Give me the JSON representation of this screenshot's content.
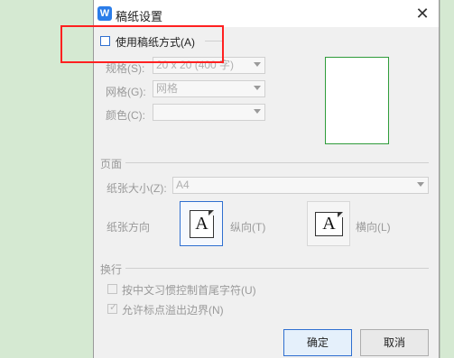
{
  "dialog": {
    "title": "稿纸设置",
    "app_icon": "W",
    "close": "✕"
  },
  "use_grid": {
    "label": "使用稿纸方式(A)",
    "checked": false
  },
  "spec": {
    "label": "规格(S):",
    "value": "20 x 20 (400 字)"
  },
  "grid": {
    "label": "网格(G):",
    "value": "网格"
  },
  "color": {
    "label": "颜色(C):",
    "value": ""
  },
  "page": {
    "section_label": "页面",
    "paper_size_label": "纸张大小(Z):",
    "paper_size_value": "A4",
    "orientation_label": "纸张方向",
    "portrait_label": "纵向(T)",
    "landscape_label": "横向(L)",
    "icon_letter": "A"
  },
  "wrap": {
    "section_label": "换行",
    "punct_control_label": "按中文习惯控制首尾字符(U)",
    "punct_control_checked": false,
    "overflow_label": "允许标点溢出边界(N)",
    "overflow_checked": true,
    "check_glyph": "✓"
  },
  "buttons": {
    "ok": "确定",
    "cancel": "取消"
  },
  "colors": {
    "background": "#d5e9d2",
    "dialog": "#f0f0f0",
    "accent": "#2f6fd0",
    "preview_border": "#2f9c3a",
    "highlight": "#ff2020"
  }
}
